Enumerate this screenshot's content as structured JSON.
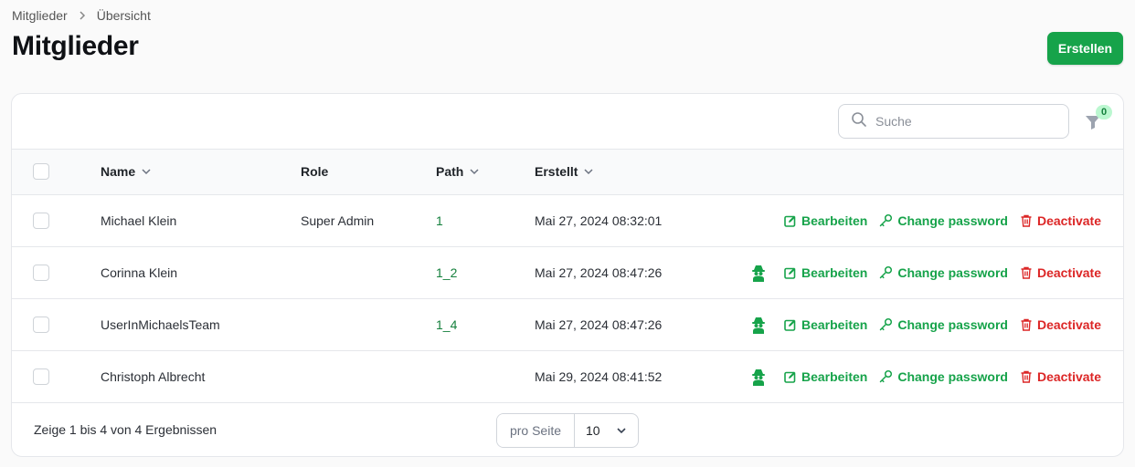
{
  "breadcrumb": {
    "items": [
      "Mitglieder",
      "Übersicht"
    ]
  },
  "page": {
    "title": "Mitglieder",
    "create_label": "Erstellen"
  },
  "search": {
    "placeholder": "Suche",
    "value": ""
  },
  "filter": {
    "count": "0"
  },
  "table": {
    "columns": {
      "name": "Name",
      "role": "Role",
      "path": "Path",
      "created": "Erstellt"
    },
    "rows": [
      {
        "name": "Michael Klein",
        "role": "Super Admin",
        "path": "1",
        "created": "Mai 27, 2024 08:32:01",
        "impersonate": false
      },
      {
        "name": "Corinna Klein",
        "role": "",
        "path": "1_2",
        "created": "Mai 27, 2024 08:47:26",
        "impersonate": true
      },
      {
        "name": "UserInMichaelsTeam",
        "role": "",
        "path": "1_4",
        "created": "Mai 27, 2024 08:47:26",
        "impersonate": true
      },
      {
        "name": "Christoph Albrecht",
        "role": "",
        "path": "",
        "created": "Mai 29, 2024 08:41:52",
        "impersonate": true
      }
    ],
    "actions": {
      "edit": "Bearbeiten",
      "password": "Change password",
      "deactivate": "Deactivate"
    }
  },
  "footer": {
    "summary": "Zeige 1 bis 4 von 4 Ergebnissen",
    "per_page_label": "pro Seite",
    "per_page_value": "10"
  },
  "colors": {
    "accent": "#16a34a",
    "danger": "#dc2626"
  },
  "icons": [
    "chevron-right-icon",
    "search-icon",
    "filter-icon",
    "chevron-down-icon",
    "spy-icon",
    "edit-icon",
    "key-icon",
    "trash-icon"
  ]
}
